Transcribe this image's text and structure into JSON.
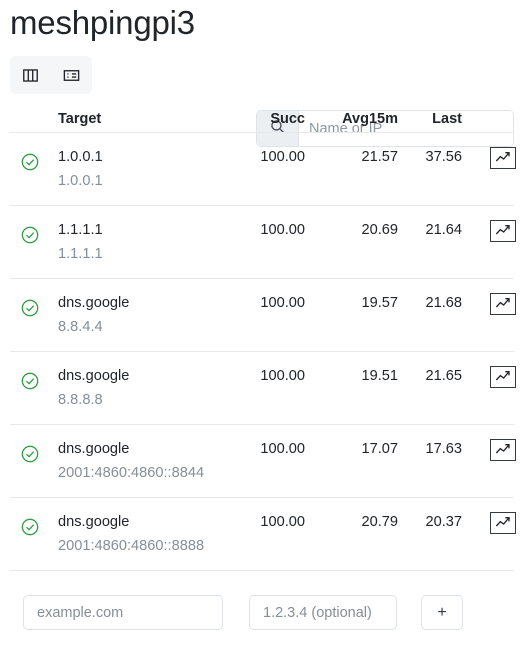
{
  "header": {
    "title": "meshpingpi3"
  },
  "toolbar": {
    "buttons": [
      {
        "name": "columns-icon",
        "label": ""
      },
      {
        "name": "list-details-icon",
        "label": ""
      }
    ]
  },
  "search": {
    "placeholder": "Name or IP",
    "value": "",
    "icon": "search-icon"
  },
  "table": {
    "columns": [
      "Target",
      "Succ",
      "Avg15m",
      "Last"
    ],
    "rows": [
      {
        "status": "ok",
        "name": "1.0.0.1",
        "address": "1.0.0.1",
        "succ": "100.00",
        "avg15m": "21.57",
        "last": "37.56",
        "chart_icon": "trending-up-icon"
      },
      {
        "status": "ok",
        "name": "1.1.1.1",
        "address": "1.1.1.1",
        "succ": "100.00",
        "avg15m": "20.69",
        "last": "21.64",
        "chart_icon": "trending-up-icon"
      },
      {
        "status": "ok",
        "name": "dns.google",
        "address": "8.8.4.4",
        "succ": "100.00",
        "avg15m": "19.57",
        "last": "21.68",
        "chart_icon": "trending-up-icon"
      },
      {
        "status": "ok",
        "name": "dns.google",
        "address": "8.8.8.8",
        "succ": "100.00",
        "avg15m": "19.51",
        "last": "21.65",
        "chart_icon": "trending-up-icon"
      },
      {
        "status": "ok",
        "name": "dns.google",
        "address": "2001:4860:4860::8844",
        "succ": "100.00",
        "avg15m": "17.07",
        "last": "17.63",
        "chart_icon": "trending-up-icon"
      },
      {
        "status": "ok",
        "name": "dns.google",
        "address": "2001:4860:4860::8888",
        "succ": "100.00",
        "avg15m": "20.79",
        "last": "20.37",
        "chart_icon": "trending-up-icon"
      }
    ]
  },
  "add_form": {
    "host_placeholder": "example.com",
    "host_value": "",
    "ip_placeholder": "1.2.3.4 (optional)",
    "ip_value": "",
    "add_label": "+"
  },
  "colors": {
    "status_ok": "#2f9e44",
    "text": "#212529",
    "muted": "#868e96",
    "border": "#dee2e6",
    "row_border": "#e6e8ea",
    "toolbar_bg": "#f4f6f8",
    "search_prefix_bg": "#eceff1"
  }
}
